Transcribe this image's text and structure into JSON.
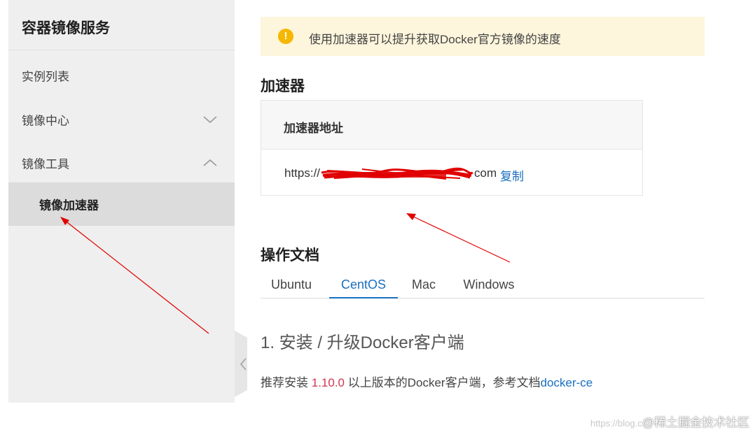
{
  "sidebar": {
    "title": "容器镜像服务",
    "items": [
      {
        "label": "实例列表"
      },
      {
        "label": "镜像中心",
        "chevron": "chevron-down-icon"
      },
      {
        "label": "镜像工具",
        "chevron": "chevron-up-icon"
      },
      {
        "label": "镜像加速器",
        "active": true
      }
    ],
    "collapse_icon": "chevron-left-icon"
  },
  "notice": {
    "icon": "warning-icon",
    "icon_glyph": "!",
    "text": "使用加速器可以提升获取Docker官方镜像的速度"
  },
  "accelerator": {
    "section_title": "加速器",
    "header_label": "加速器地址",
    "url_prefix": "https://",
    "url_suffix": "com",
    "copy_label": "复制"
  },
  "docs": {
    "section_title": "操作文档",
    "tabs": [
      {
        "label": "Ubuntu"
      },
      {
        "label": "CentOS",
        "active": true
      },
      {
        "label": "Mac"
      },
      {
        "label": "Windows"
      }
    ],
    "install_heading": "1. 安装 / 升级Docker客户端",
    "install_text_before": "推荐安装 ",
    "install_version": "1.10.0",
    "install_text_after": " 以上版本的Docker客户端，参考文档",
    "install_link": "docker-ce"
  },
  "watermark": {
    "prefix": "https://blog.c",
    "text": "@稀土掘金技术社区"
  },
  "colors": {
    "accent": "#1a6fc0",
    "warning": "#f5b800",
    "notice_bg": "#fdf5dc",
    "version": "#d0364f",
    "annotation": "#e00000"
  }
}
